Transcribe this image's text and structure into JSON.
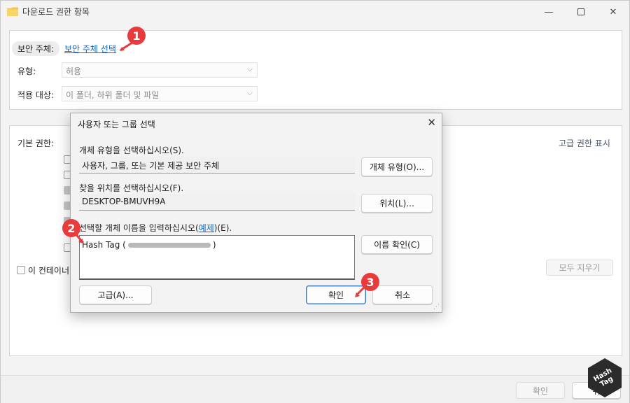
{
  "window": {
    "title": "다운로드 권한 항목",
    "folder_color": "#f4c542"
  },
  "top_panel": {
    "principal_label": "보안 주체:",
    "principal_link": "보안 주체 선택",
    "type_label": "유형:",
    "type_value": "허용",
    "applies_label": "적용 대상:",
    "applies_value": "이 폴더, 하위 폴더 및 파일"
  },
  "perm_panel": {
    "basic_label": "기본 권한:",
    "advanced_link": "고급 권한 표시",
    "inherit_label": "이 컨테이너",
    "clear_all": "모두 지우기"
  },
  "footer": {
    "ok": "확인",
    "cancel": "취"
  },
  "dialog": {
    "title": "사용자 또는 그룹 선택",
    "object_type_label": "개체 유형을 선택하십시오(S).",
    "object_type_value": "사용자, 그룹, 또는 기본 제공 보안 주체",
    "object_type_button": "개체 유형(O)...",
    "location_label": "찾을 위치를 선택하십시오(F).",
    "location_value": "DESKTOP-BMUVH9A",
    "location_button": "위치(L)...",
    "name_label_prefix": "선택할 개체 이름을 입력하십시오(",
    "name_label_link": "예제",
    "name_label_suffix": ")(E).",
    "name_value": "Hash Tag (",
    "name_value_end": ")",
    "check_names_button": "이름 확인(C)",
    "advanced_button": "고급(A)...",
    "ok_button": "확인",
    "cancel_button": "취소"
  },
  "badges": [
    "1",
    "2",
    "3"
  ],
  "accent_color": "#e83b3b"
}
